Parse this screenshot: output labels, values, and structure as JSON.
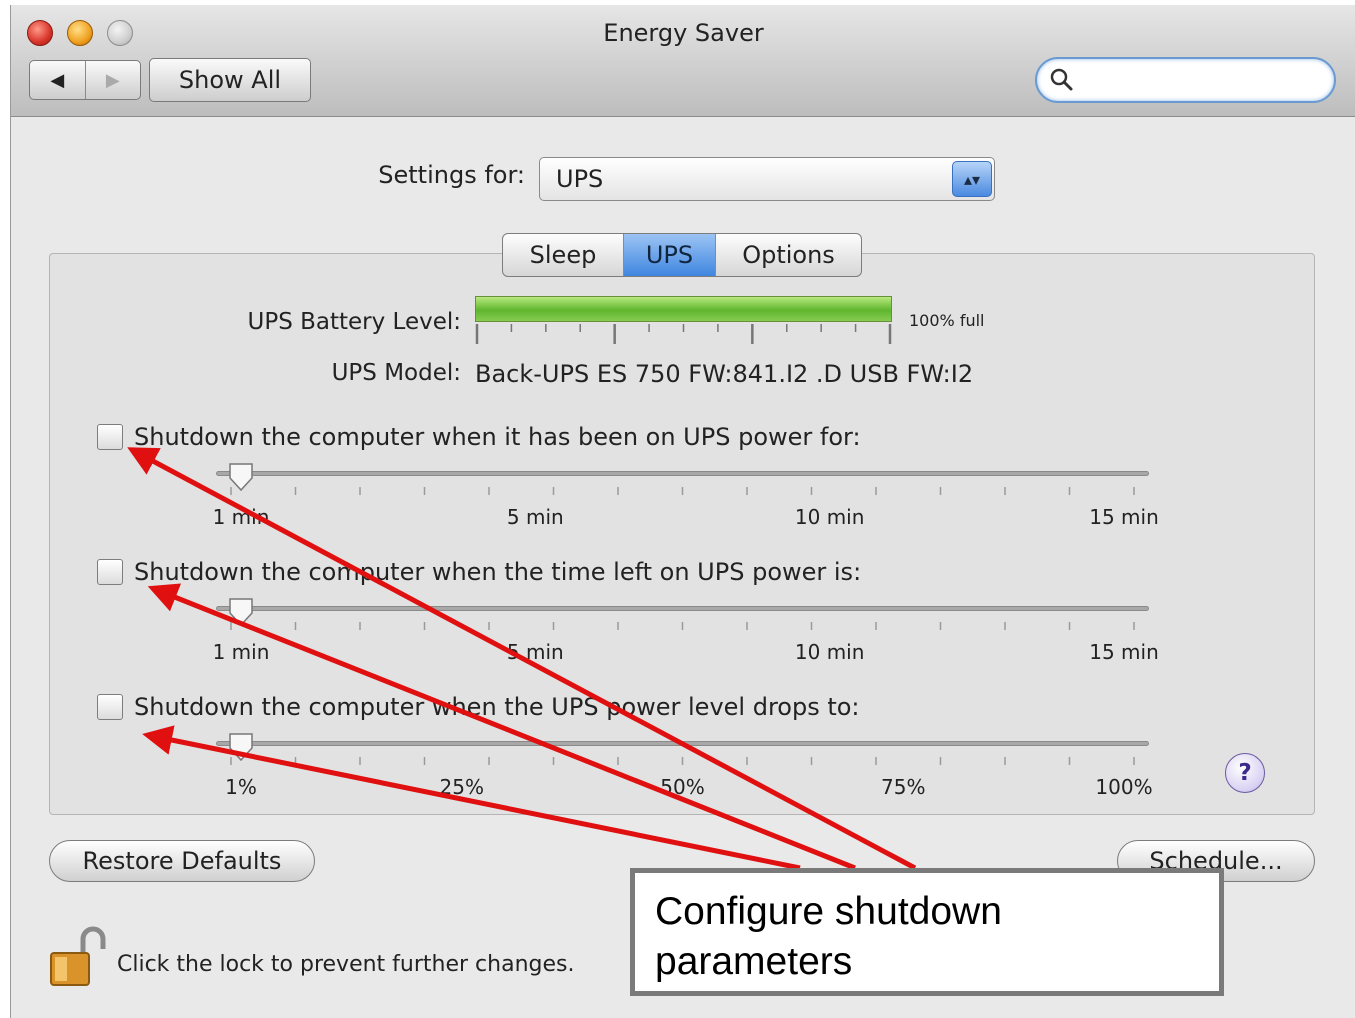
{
  "window": {
    "title": "Energy Saver",
    "show_all": "Show All",
    "back_icon": "◀",
    "forward_icon": "▶",
    "search_placeholder": ""
  },
  "settings": {
    "label": "Settings for:",
    "selected": "UPS",
    "arrows_icon": "▴▾"
  },
  "tabs": [
    {
      "label": "Sleep",
      "selected": false
    },
    {
      "label": "UPS",
      "selected": true
    },
    {
      "label": "Options",
      "selected": false
    }
  ],
  "ups": {
    "battery_label": "UPS Battery Level:",
    "battery_level": 1.0,
    "battery_text": "100% full",
    "model_label": "UPS Model:",
    "model_value": "Back-UPS ES 750 FW:841.I2 .D USB FW:I2"
  },
  "shutdown_options": [
    {
      "label": "Shutdown the computer when it has been on UPS power for:",
      "checked": false,
      "slider_value": "1 min",
      "tick_labels": [
        "1 min",
        "5 min",
        "10 min",
        "15 min"
      ]
    },
    {
      "label": "Shutdown the computer when the time left on UPS power is:",
      "checked": false,
      "slider_value": "1 min",
      "tick_labels": [
        "1 min",
        "5 min",
        "10 min",
        "15 min"
      ]
    },
    {
      "label": "Shutdown the computer when the UPS power level drops to:",
      "checked": false,
      "slider_value": "1%",
      "tick_labels": [
        "1%",
        "25%",
        "50%",
        "75%",
        "100%"
      ]
    }
  ],
  "help_label": "?",
  "buttons": {
    "restore_defaults": "Restore Defaults",
    "schedule": "Schedule..."
  },
  "lock_text": "Click the lock to prevent further changes.",
  "callout": {
    "line1": "Configure shutdown",
    "line2": "parameters"
  },
  "colors": {
    "battery_green": "#5fb52d",
    "selected_tab": "#3f86e0",
    "annotation_arrow": "#e01010"
  }
}
